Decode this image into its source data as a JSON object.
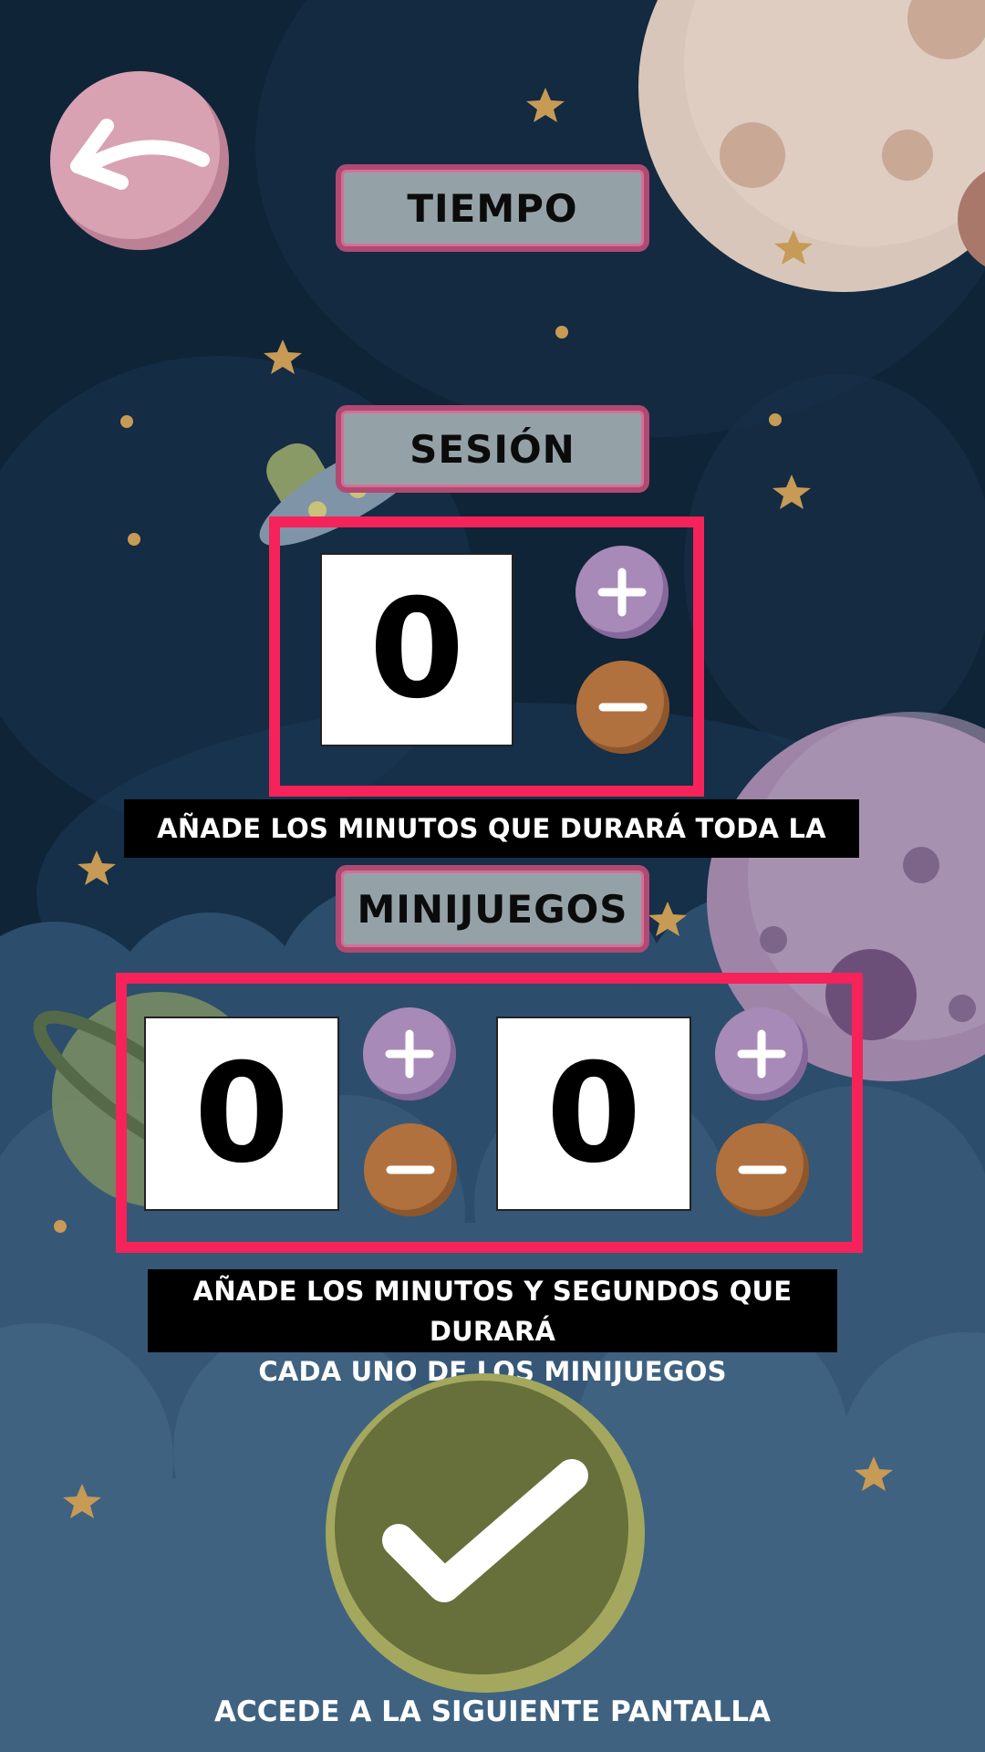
{
  "header": {
    "back_icon": "arrow-left-icon",
    "title": "TIEMPO"
  },
  "session": {
    "label": "SESIÓN",
    "minutes_value": "0",
    "caption": "AÑADE LOS MINUTOS QUE DURARÁ TODA LA SESIÓN"
  },
  "minigames": {
    "label": "MINIJUEGOS",
    "minutes_value": "0",
    "seconds_value": "0",
    "caption_line1": "AÑADE LOS MINUTOS Y SEGUNDOS QUE DURARÁ",
    "caption_line2": "CADA UNO DE LOS MINIJUEGOS"
  },
  "footer": {
    "confirm_icon": "checkmark-icon",
    "caption": "ACCEDE A LA SIGUIENTE PANTALLA"
  },
  "colors": {
    "frame": "#f5235a",
    "plus_button": "#a78ab8",
    "minus_button": "#b0713f",
    "confirm_button": "#676f3b",
    "back_button": "#d8a2b3"
  }
}
